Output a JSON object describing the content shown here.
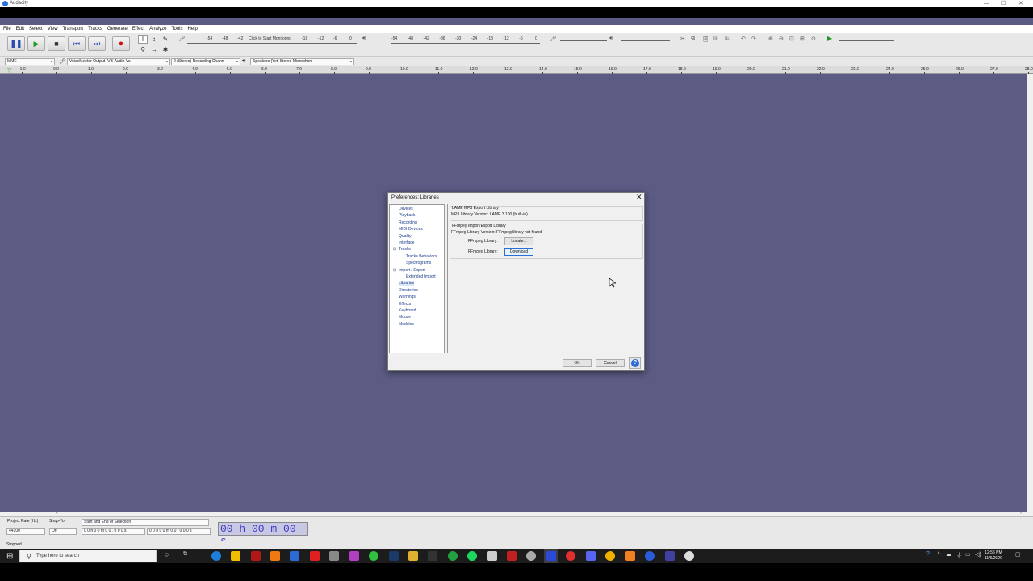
{
  "window": {
    "title": "Audacity"
  },
  "menu": [
    "File",
    "Edit",
    "Select",
    "View",
    "Transport",
    "Tracks",
    "Generate",
    "Effect",
    "Analyze",
    "Tools",
    "Help"
  ],
  "meters": {
    "record_click_label": "Click to Start Monitoring",
    "record_ticks": [
      "-54",
      "-48",
      "-42",
      "-18",
      "-12",
      "-6",
      "0"
    ],
    "play_ticks": [
      "-54",
      "-48",
      "-42",
      "-36",
      "-30",
      "-24",
      "-18",
      "-12",
      "-6",
      "0"
    ]
  },
  "devices": {
    "host": "MME",
    "recording_device": "VoiceMeeter Output (VB-Audio Vo",
    "channels": "2 (Stereo) Recording Chann",
    "playback_device": "Speakers (Yeti Stereo Microphon"
  },
  "ruler_ticks": [
    "-1.0",
    "0.0",
    "1.0",
    "2.0",
    "3.0",
    "4.0",
    "5.0",
    "6.0",
    "7.0",
    "8.0",
    "9.0",
    "10.0",
    "11.0",
    "12.0",
    "13.0",
    "14.0",
    "15.0",
    "16.0",
    "17.0",
    "18.0",
    "19.0",
    "20.0",
    "21.0",
    "22.0",
    "23.0",
    "24.0",
    "25.0",
    "26.0",
    "27.0",
    "28.0"
  ],
  "dialog": {
    "title": "Preferences: Libraries",
    "tree": [
      {
        "label": "Devices",
        "indent": 0
      },
      {
        "label": "Playback",
        "indent": 0
      },
      {
        "label": "Recording",
        "indent": 0
      },
      {
        "label": "MIDI Devices",
        "indent": 0
      },
      {
        "label": "Quality",
        "indent": 0
      },
      {
        "label": "Interface",
        "indent": 0
      },
      {
        "label": "Tracks",
        "indent": 0,
        "expander": "⊟"
      },
      {
        "label": "Tracks Behaviors",
        "indent": 1
      },
      {
        "label": "Spectrograms",
        "indent": 1
      },
      {
        "label": "Import / Export",
        "indent": 0,
        "expander": "⊟"
      },
      {
        "label": "Extended Import",
        "indent": 1
      },
      {
        "label": "Libraries",
        "indent": 0
      },
      {
        "label": "Directories",
        "indent": 0
      },
      {
        "label": "Warnings",
        "indent": 0
      },
      {
        "label": "Effects",
        "indent": 0
      },
      {
        "label": "Keyboard",
        "indent": 0
      },
      {
        "label": "Mouse",
        "indent": 0
      },
      {
        "label": "Modules",
        "indent": 0
      }
    ],
    "lame_group_title": "LAME MP3 Export Library",
    "mp3_version_label": "MP3 Library Version:",
    "mp3_version_value": "LAME 3.100 (built-in)",
    "ffmpeg_group_title": "FFmpeg Import/Export Library",
    "ffmpeg_version_label": "FFmpeg Library Version:",
    "ffmpeg_version_value": "FFmpeg library not found",
    "ffmpeg_library_label": "FFmpeg Library:",
    "locate_label": "Locate...",
    "download_label": "Download",
    "ok_label": "OK",
    "cancel_label": "Cancel",
    "help_label": "?"
  },
  "selection_bar": {
    "project_rate_label": "Project Rate (Hz)",
    "project_rate_value": "44100",
    "snap_to_label": "Snap-To",
    "snap_to_value": "Off",
    "selection_mode": "Start and End of Selection",
    "start_time": "0 0 h 0 0 m 0 0 . 0 0 0 s",
    "end_time": "0 0 h 0 0 m 0 0 . 0 0 0 s",
    "audio_position": "00 h 00 m 00 s"
  },
  "status": "Stopped.",
  "taskbar": {
    "search_placeholder": "Type here to search",
    "time": "12:56 PM",
    "date": "11/6/2020"
  }
}
